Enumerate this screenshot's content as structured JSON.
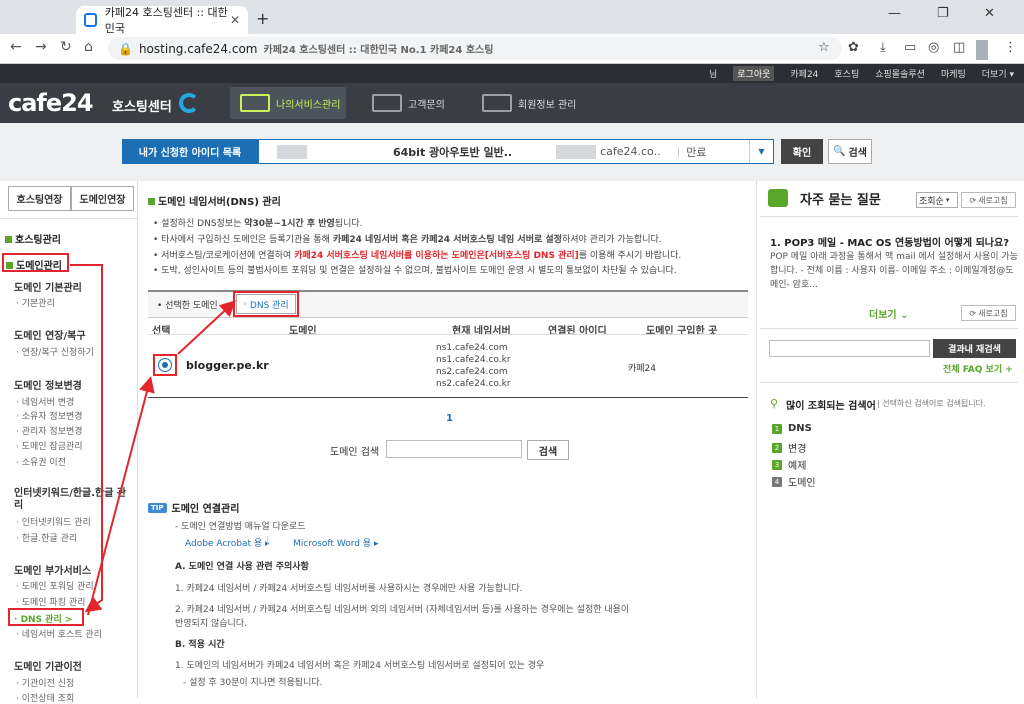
{
  "browser": {
    "tab_title": "카페24 호스팅센터 :: 대한민국",
    "url_host": "hosting.cafe24.com",
    "url_title": "카페24 호스팅센터 :: 대한민국 No.1 카페24 호스팅"
  },
  "topbar": {
    "user_initial": "님",
    "links": [
      "로그아웃",
      "카페24",
      "호스팅",
      "쇼핑몰솔루션",
      "마케팅",
      "더보기 ▾"
    ]
  },
  "header": {
    "logo": "cafe24",
    "logo_sub": "호스팅센터",
    "nav": [
      "나의서비스관리",
      "고객문의",
      "회원정보 관리"
    ]
  },
  "idbar": {
    "label": "내가 신청한 아이디 목록",
    "product": "64bit 광아우토반 일반..",
    "domain_suffix": "cafe24.co..",
    "separator": "|",
    "status": "만료",
    "dropdown": "▼",
    "confirm": "확인",
    "search": "검색"
  },
  "left": {
    "btn_hosting": "호스팅연장",
    "btn_domain": "도메인연장",
    "hosting_mgmt": "호스팅관리",
    "domain_mgmt": "도메인관리",
    "groups": {
      "basic": {
        "title": "도메인 기본관리",
        "items": [
          "기본관리"
        ]
      },
      "extend": {
        "title": "도메인 연장/복구",
        "items": [
          "연장/복구 신청하기"
        ]
      },
      "info": {
        "title": "도메인 정보변경",
        "items": [
          "네임서버 변경",
          "소유자 정보변경",
          "관리자 정보변경",
          "도메인 잠금관리",
          "소유권 이전"
        ]
      },
      "keyword": {
        "title": "인터넷키워드/한글.한글 관리",
        "items": [
          "인터넷키워드 관리",
          "한글.한글 관리"
        ]
      },
      "extra": {
        "title": "도메인 부가서비스",
        "items": [
          "도메인 포워딩 관리",
          "도메인 파킹 관리",
          "DNS 관리 >",
          "네임서버 호스트 관리"
        ]
      },
      "transfer": {
        "title": "도메인 기관이전",
        "items": [
          "기관이전 신청",
          "이전상태 조회"
        ]
      }
    }
  },
  "main": {
    "title": "도메인 네임서버(DNS) 관리",
    "notes": [
      {
        "a": "설정하신 DNS정보는 ",
        "b": "약30분~1시간 후 반영",
        "c": "됩니다."
      },
      {
        "a": "타사에서 구입하신 도메인은 등록기관을 통해 ",
        "b": "카페24 네임서버 혹은 카페24 서버호스팅 네임 서버로 설정",
        "c": "하셔야 관리가 가능합니다."
      },
      {
        "a": "서버호스팅/코로케이션에 연결하여 ",
        "b": "카페24 서버호스팅 네임서버를 이용하는 도메인은[서버호스팅 DNS 관리]",
        "c": "를 이용해 주시기 바랍니다."
      },
      {
        "a": "도박, 성인사이트 등의 불법사이트 포워딩 및 연결은 설정하실 수 없으며, 불법사이트 도메인 운영 시 별도의 통보없이 차단될 수 있습니다.",
        "b": "",
        "c": ""
      }
    ],
    "selected_label": "선택한 도메인",
    "dns_btn": "DNS 관리",
    "table_headers": [
      "선택",
      "도메인",
      "현재 네임서버",
      "연결된 아이디",
      "도메인 구입한 곳"
    ],
    "row": {
      "domain": "blogger.pe.kr",
      "nameservers": [
        "ns1.cafe24.com",
        "ns1.cafe24.co.kr",
        "ns2.cafe24.com",
        "ns2.cafe24.co.kr"
      ],
      "registrar": "카페24"
    },
    "page": "1",
    "domain_search_label": "도메인 검색",
    "domain_search_btn": "검색",
    "tip_badge": "TIP",
    "conn_title": "도메인 연결관리",
    "manual": "도메인 연결방법 매뉴얼 다운로드",
    "adobe": "Adobe Acrobat 용",
    "msword": "Microsoft Word 용",
    "sec_a": "A. 도메인 연결 사용 관련 주의사항",
    "a1": "1. 카페24 네임서버 / 카페24 서버호스팅 네임서버를 사용하시는 경우에만 사용 가능합니다.",
    "a2a": "2. 카페24 네임서버 / 카페24 서버호스팅 네임서버 외의 네임서버 (자체네임서버 등)를 사용하는 경우에는 설정한 내용이",
    "a2b": "반영되지 않습니다.",
    "sec_b": "B. 적용 시간",
    "b1": "1. 도메인의 네임서버가 카페24 네임서버 혹은 카페24 서버호스팅 네임서버로 설정되어 있는 경우",
    "b1s": "- 설정 후 30분이 지나면 적용됩니다."
  },
  "right": {
    "faq_title": "자주 묻는 질문",
    "sort": "조회순",
    "refresh": "새로고침",
    "faq_q": "1. POP3 메일 - MAC OS 연동방법이 어떻게 되나요?",
    "faq_a": "POP 메일 아래 과정을 통해서 맥 mail 에서 설정해서 사용이 가능합니다. - 전체 이름 : 사용자 이름- 이메일 주소 : 이메일계정@도메인- 암호...",
    "more": "더보기",
    "search_btn": "결과내 재검색",
    "all_faq": "전체 FAQ 보기 +",
    "popular_title": "많이 조회되는 검색어",
    "popular_sub": "| 선택하신 검색어로 검색됩니다.",
    "popular": [
      "DNS",
      "변경",
      "예제",
      "도메인"
    ],
    "ranks": [
      "1",
      "2",
      "3",
      "4"
    ]
  },
  "colors": {
    "accent_green": "#5aa62a",
    "primary_blue": "#1c6fb5",
    "highlight_red": "#e2262b",
    "header_dark": "#3a3e44"
  }
}
